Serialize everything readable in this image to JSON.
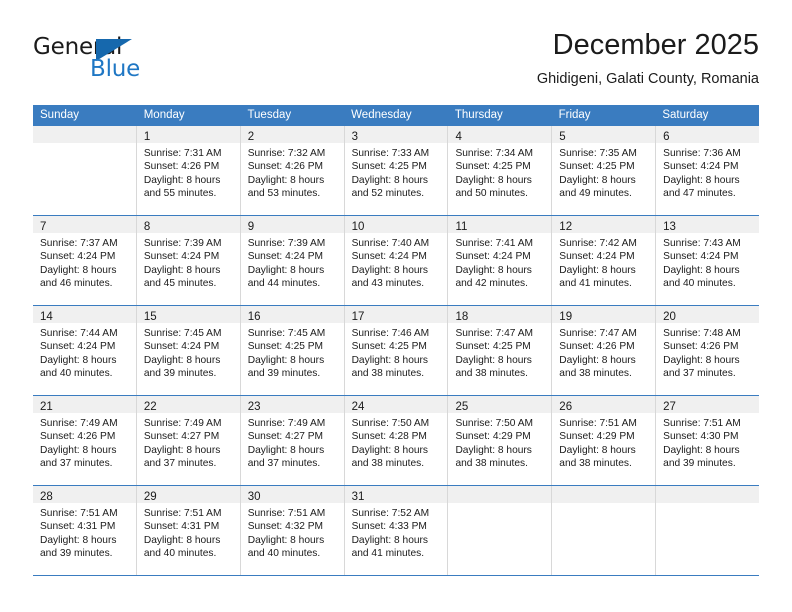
{
  "brand": {
    "name_part1": "General",
    "name_part2": "Blue",
    "triangle_icon": "triangle-icon",
    "accent_color": "#1f77c4"
  },
  "header": {
    "title": "December 2025",
    "subtitle": "Ghidigeni, Galati County, Romania"
  },
  "calendar": {
    "header_bg": "#3a7cc0",
    "daynum_bg": "#f0f0f0",
    "weekdays": [
      "Sunday",
      "Monday",
      "Tuesday",
      "Wednesday",
      "Thursday",
      "Friday",
      "Saturday"
    ],
    "weeks": [
      [
        {
          "day": "",
          "sunrise": "",
          "sunset": "",
          "daylight1": "",
          "daylight2": ""
        },
        {
          "day": "1",
          "sunrise": "Sunrise: 7:31 AM",
          "sunset": "Sunset: 4:26 PM",
          "daylight1": "Daylight: 8 hours",
          "daylight2": "and 55 minutes."
        },
        {
          "day": "2",
          "sunrise": "Sunrise: 7:32 AM",
          "sunset": "Sunset: 4:26 PM",
          "daylight1": "Daylight: 8 hours",
          "daylight2": "and 53 minutes."
        },
        {
          "day": "3",
          "sunrise": "Sunrise: 7:33 AM",
          "sunset": "Sunset: 4:25 PM",
          "daylight1": "Daylight: 8 hours",
          "daylight2": "and 52 minutes."
        },
        {
          "day": "4",
          "sunrise": "Sunrise: 7:34 AM",
          "sunset": "Sunset: 4:25 PM",
          "daylight1": "Daylight: 8 hours",
          "daylight2": "and 50 minutes."
        },
        {
          "day": "5",
          "sunrise": "Sunrise: 7:35 AM",
          "sunset": "Sunset: 4:25 PM",
          "daylight1": "Daylight: 8 hours",
          "daylight2": "and 49 minutes."
        },
        {
          "day": "6",
          "sunrise": "Sunrise: 7:36 AM",
          "sunset": "Sunset: 4:24 PM",
          "daylight1": "Daylight: 8 hours",
          "daylight2": "and 47 minutes."
        }
      ],
      [
        {
          "day": "7",
          "sunrise": "Sunrise: 7:37 AM",
          "sunset": "Sunset: 4:24 PM",
          "daylight1": "Daylight: 8 hours",
          "daylight2": "and 46 minutes."
        },
        {
          "day": "8",
          "sunrise": "Sunrise: 7:39 AM",
          "sunset": "Sunset: 4:24 PM",
          "daylight1": "Daylight: 8 hours",
          "daylight2": "and 45 minutes."
        },
        {
          "day": "9",
          "sunrise": "Sunrise: 7:39 AM",
          "sunset": "Sunset: 4:24 PM",
          "daylight1": "Daylight: 8 hours",
          "daylight2": "and 44 minutes."
        },
        {
          "day": "10",
          "sunrise": "Sunrise: 7:40 AM",
          "sunset": "Sunset: 4:24 PM",
          "daylight1": "Daylight: 8 hours",
          "daylight2": "and 43 minutes."
        },
        {
          "day": "11",
          "sunrise": "Sunrise: 7:41 AM",
          "sunset": "Sunset: 4:24 PM",
          "daylight1": "Daylight: 8 hours",
          "daylight2": "and 42 minutes."
        },
        {
          "day": "12",
          "sunrise": "Sunrise: 7:42 AM",
          "sunset": "Sunset: 4:24 PM",
          "daylight1": "Daylight: 8 hours",
          "daylight2": "and 41 minutes."
        },
        {
          "day": "13",
          "sunrise": "Sunrise: 7:43 AM",
          "sunset": "Sunset: 4:24 PM",
          "daylight1": "Daylight: 8 hours",
          "daylight2": "and 40 minutes."
        }
      ],
      [
        {
          "day": "14",
          "sunrise": "Sunrise: 7:44 AM",
          "sunset": "Sunset: 4:24 PM",
          "daylight1": "Daylight: 8 hours",
          "daylight2": "and 40 minutes."
        },
        {
          "day": "15",
          "sunrise": "Sunrise: 7:45 AM",
          "sunset": "Sunset: 4:24 PM",
          "daylight1": "Daylight: 8 hours",
          "daylight2": "and 39 minutes."
        },
        {
          "day": "16",
          "sunrise": "Sunrise: 7:45 AM",
          "sunset": "Sunset: 4:25 PM",
          "daylight1": "Daylight: 8 hours",
          "daylight2": "and 39 minutes."
        },
        {
          "day": "17",
          "sunrise": "Sunrise: 7:46 AM",
          "sunset": "Sunset: 4:25 PM",
          "daylight1": "Daylight: 8 hours",
          "daylight2": "and 38 minutes."
        },
        {
          "day": "18",
          "sunrise": "Sunrise: 7:47 AM",
          "sunset": "Sunset: 4:25 PM",
          "daylight1": "Daylight: 8 hours",
          "daylight2": "and 38 minutes."
        },
        {
          "day": "19",
          "sunrise": "Sunrise: 7:47 AM",
          "sunset": "Sunset: 4:26 PM",
          "daylight1": "Daylight: 8 hours",
          "daylight2": "and 38 minutes."
        },
        {
          "day": "20",
          "sunrise": "Sunrise: 7:48 AM",
          "sunset": "Sunset: 4:26 PM",
          "daylight1": "Daylight: 8 hours",
          "daylight2": "and 37 minutes."
        }
      ],
      [
        {
          "day": "21",
          "sunrise": "Sunrise: 7:49 AM",
          "sunset": "Sunset: 4:26 PM",
          "daylight1": "Daylight: 8 hours",
          "daylight2": "and 37 minutes."
        },
        {
          "day": "22",
          "sunrise": "Sunrise: 7:49 AM",
          "sunset": "Sunset: 4:27 PM",
          "daylight1": "Daylight: 8 hours",
          "daylight2": "and 37 minutes."
        },
        {
          "day": "23",
          "sunrise": "Sunrise: 7:49 AM",
          "sunset": "Sunset: 4:27 PM",
          "daylight1": "Daylight: 8 hours",
          "daylight2": "and 37 minutes."
        },
        {
          "day": "24",
          "sunrise": "Sunrise: 7:50 AM",
          "sunset": "Sunset: 4:28 PM",
          "daylight1": "Daylight: 8 hours",
          "daylight2": "and 38 minutes."
        },
        {
          "day": "25",
          "sunrise": "Sunrise: 7:50 AM",
          "sunset": "Sunset: 4:29 PM",
          "daylight1": "Daylight: 8 hours",
          "daylight2": "and 38 minutes."
        },
        {
          "day": "26",
          "sunrise": "Sunrise: 7:51 AM",
          "sunset": "Sunset: 4:29 PM",
          "daylight1": "Daylight: 8 hours",
          "daylight2": "and 38 minutes."
        },
        {
          "day": "27",
          "sunrise": "Sunrise: 7:51 AM",
          "sunset": "Sunset: 4:30 PM",
          "daylight1": "Daylight: 8 hours",
          "daylight2": "and 39 minutes."
        }
      ],
      [
        {
          "day": "28",
          "sunrise": "Sunrise: 7:51 AM",
          "sunset": "Sunset: 4:31 PM",
          "daylight1": "Daylight: 8 hours",
          "daylight2": "and 39 minutes."
        },
        {
          "day": "29",
          "sunrise": "Sunrise: 7:51 AM",
          "sunset": "Sunset: 4:31 PM",
          "daylight1": "Daylight: 8 hours",
          "daylight2": "and 40 minutes."
        },
        {
          "day": "30",
          "sunrise": "Sunrise: 7:51 AM",
          "sunset": "Sunset: 4:32 PM",
          "daylight1": "Daylight: 8 hours",
          "daylight2": "and 40 minutes."
        },
        {
          "day": "31",
          "sunrise": "Sunrise: 7:52 AM",
          "sunset": "Sunset: 4:33 PM",
          "daylight1": "Daylight: 8 hours",
          "daylight2": "and 41 minutes."
        },
        {
          "day": "",
          "sunrise": "",
          "sunset": "",
          "daylight1": "",
          "daylight2": ""
        },
        {
          "day": "",
          "sunrise": "",
          "sunset": "",
          "daylight1": "",
          "daylight2": ""
        },
        {
          "day": "",
          "sunrise": "",
          "sunset": "",
          "daylight1": "",
          "daylight2": ""
        }
      ]
    ]
  }
}
